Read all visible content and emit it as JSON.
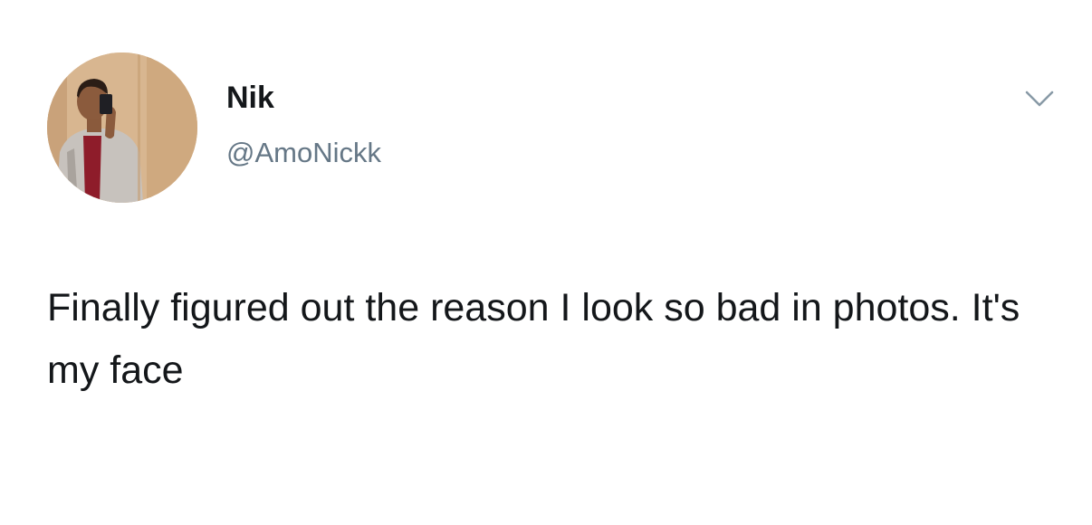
{
  "tweet": {
    "author": {
      "display_name": "Nik",
      "handle": "@AmoNickk",
      "avatar_icon": "user-avatar-photo"
    },
    "menu_icon": "chevron-down-icon",
    "text": "Finally figured out the reason I look so bad in photos. It's my face"
  },
  "colors": {
    "text_primary": "#14171a",
    "text_secondary": "#657786",
    "background": "#ffffff"
  }
}
